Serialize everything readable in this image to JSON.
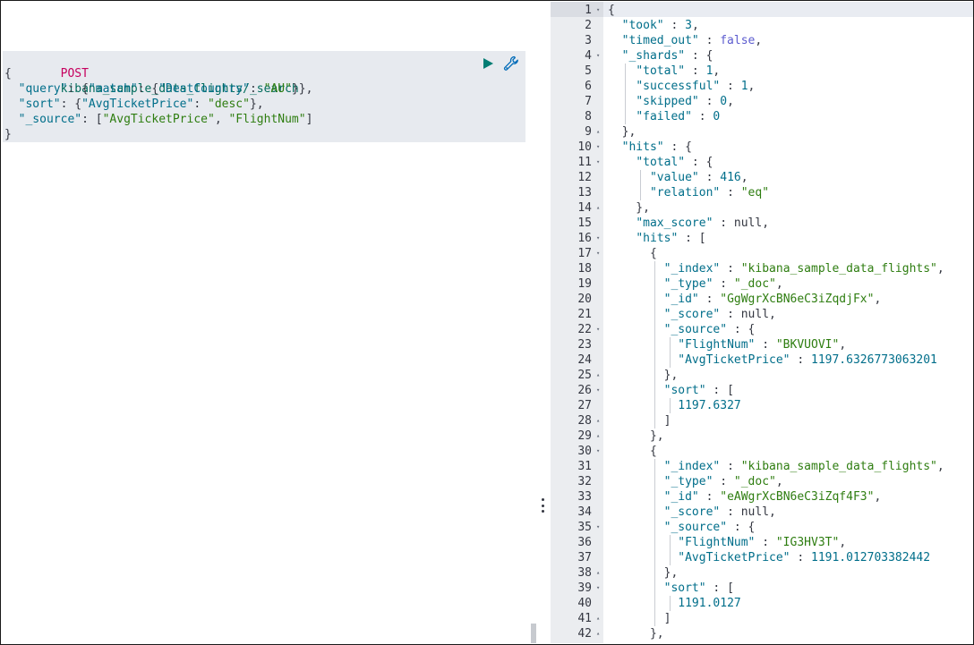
{
  "request": {
    "method": "POST",
    "path": "kibana_sample_data_flights/_search",
    "body": [
      [
        [
          "punc",
          "{"
        ]
      ],
      [
        [
          "punc",
          "  "
        ],
        [
          "key",
          "\"query\""
        ],
        [
          "punc",
          ": {"
        ],
        [
          "key",
          "\"match\""
        ],
        [
          "punc",
          ": {"
        ],
        [
          "key",
          "\"DestCountry\""
        ],
        [
          "punc",
          ": "
        ],
        [
          "str",
          "\"AU\""
        ],
        [
          "punc",
          "}},"
        ]
      ],
      [
        [
          "punc",
          "  "
        ],
        [
          "key",
          "\"sort\""
        ],
        [
          "punc",
          ": {"
        ],
        [
          "key",
          "\"AvgTicketPrice\""
        ],
        [
          "punc",
          ": "
        ],
        [
          "str",
          "\"desc\""
        ],
        [
          "punc",
          "},"
        ]
      ],
      [
        [
          "punc",
          "  "
        ],
        [
          "key",
          "\"_source\""
        ],
        [
          "punc",
          ": ["
        ],
        [
          "str",
          "\"AvgTicketPrice\""
        ],
        [
          "punc",
          ", "
        ],
        [
          "str",
          "\"FlightNum\""
        ],
        [
          "punc",
          "]"
        ]
      ],
      [
        [
          "punc",
          "}"
        ]
      ]
    ],
    "play_icon": "play-icon",
    "wrench_icon": "wrench-icon",
    "accent_color": "#017d73"
  },
  "response": {
    "lines": [
      {
        "n": "1",
        "fold": "▾",
        "t": [
          [
            "p",
            "{"
          ]
        ]
      },
      {
        "n": "2",
        "fold": "",
        "t": [
          [
            "p",
            "  "
          ],
          [
            "k",
            "\"took\""
          ],
          [
            "p",
            " : "
          ],
          [
            "n",
            "3"
          ],
          [
            "p",
            ","
          ]
        ]
      },
      {
        "n": "3",
        "fold": "",
        "t": [
          [
            "p",
            "  "
          ],
          [
            "k",
            "\"timed_out\""
          ],
          [
            "p",
            " : "
          ],
          [
            "b",
            "false"
          ],
          [
            "p",
            ","
          ]
        ]
      },
      {
        "n": "4",
        "fold": "▾",
        "t": [
          [
            "p",
            "  "
          ],
          [
            "k",
            "\"_shards\""
          ],
          [
            "p",
            " : {"
          ]
        ]
      },
      {
        "n": "5",
        "fold": "",
        "t": [
          [
            "p",
            "    "
          ],
          [
            "k",
            "\"total\""
          ],
          [
            "p",
            " : "
          ],
          [
            "n",
            "1"
          ],
          [
            "p",
            ","
          ]
        ]
      },
      {
        "n": "6",
        "fold": "",
        "t": [
          [
            "p",
            "    "
          ],
          [
            "k",
            "\"successful\""
          ],
          [
            "p",
            " : "
          ],
          [
            "n",
            "1"
          ],
          [
            "p",
            ","
          ]
        ]
      },
      {
        "n": "7",
        "fold": "",
        "t": [
          [
            "p",
            "    "
          ],
          [
            "k",
            "\"skipped\""
          ],
          [
            "p",
            " : "
          ],
          [
            "n",
            "0"
          ],
          [
            "p",
            ","
          ]
        ]
      },
      {
        "n": "8",
        "fold": "",
        "t": [
          [
            "p",
            "    "
          ],
          [
            "k",
            "\"failed\""
          ],
          [
            "p",
            " : "
          ],
          [
            "n",
            "0"
          ]
        ]
      },
      {
        "n": "9",
        "fold": "▴",
        "t": [
          [
            "p",
            "  },"
          ]
        ]
      },
      {
        "n": "10",
        "fold": "▾",
        "t": [
          [
            "p",
            "  "
          ],
          [
            "k",
            "\"hits\""
          ],
          [
            "p",
            " : {"
          ]
        ]
      },
      {
        "n": "11",
        "fold": "▾",
        "t": [
          [
            "p",
            "    "
          ],
          [
            "k",
            "\"total\""
          ],
          [
            "p",
            " : {"
          ]
        ]
      },
      {
        "n": "12",
        "fold": "",
        "t": [
          [
            "p",
            "      "
          ],
          [
            "k",
            "\"value\""
          ],
          [
            "p",
            " : "
          ],
          [
            "n",
            "416"
          ],
          [
            "p",
            ","
          ]
        ]
      },
      {
        "n": "13",
        "fold": "",
        "t": [
          [
            "p",
            "      "
          ],
          [
            "k",
            "\"relation\""
          ],
          [
            "p",
            " : "
          ],
          [
            "s",
            "\"eq\""
          ]
        ]
      },
      {
        "n": "14",
        "fold": "▴",
        "t": [
          [
            "p",
            "    },"
          ]
        ]
      },
      {
        "n": "15",
        "fold": "",
        "t": [
          [
            "p",
            "    "
          ],
          [
            "k",
            "\"max_score\""
          ],
          [
            "p",
            " : null,"
          ]
        ]
      },
      {
        "n": "16",
        "fold": "▾",
        "t": [
          [
            "p",
            "    "
          ],
          [
            "k",
            "\"hits\""
          ],
          [
            "p",
            " : ["
          ]
        ]
      },
      {
        "n": "17",
        "fold": "▾",
        "t": [
          [
            "p",
            "      {"
          ]
        ]
      },
      {
        "n": "18",
        "fold": "",
        "t": [
          [
            "p",
            "        "
          ],
          [
            "k",
            "\"_index\""
          ],
          [
            "p",
            " : "
          ],
          [
            "s",
            "\"kibana_sample_data_flights\""
          ],
          [
            "p",
            ","
          ]
        ]
      },
      {
        "n": "19",
        "fold": "",
        "t": [
          [
            "p",
            "        "
          ],
          [
            "k",
            "\"_type\""
          ],
          [
            "p",
            " : "
          ],
          [
            "s",
            "\"_doc\""
          ],
          [
            "p",
            ","
          ]
        ]
      },
      {
        "n": "20",
        "fold": "",
        "t": [
          [
            "p",
            "        "
          ],
          [
            "k",
            "\"_id\""
          ],
          [
            "p",
            " : "
          ],
          [
            "s",
            "\"GgWgrXcBN6eC3iZqdjFx\""
          ],
          [
            "p",
            ","
          ]
        ]
      },
      {
        "n": "21",
        "fold": "",
        "t": [
          [
            "p",
            "        "
          ],
          [
            "k",
            "\"_score\""
          ],
          [
            "p",
            " : null,"
          ]
        ]
      },
      {
        "n": "22",
        "fold": "▾",
        "t": [
          [
            "p",
            "        "
          ],
          [
            "k",
            "\"_source\""
          ],
          [
            "p",
            " : {"
          ]
        ]
      },
      {
        "n": "23",
        "fold": "",
        "t": [
          [
            "p",
            "          "
          ],
          [
            "k",
            "\"FlightNum\""
          ],
          [
            "p",
            " : "
          ],
          [
            "s",
            "\"BKVUOVI\""
          ],
          [
            "p",
            ","
          ]
        ]
      },
      {
        "n": "24",
        "fold": "",
        "t": [
          [
            "p",
            "          "
          ],
          [
            "k",
            "\"AvgTicketPrice\""
          ],
          [
            "p",
            " : "
          ],
          [
            "n",
            "1197.6326773063201"
          ]
        ]
      },
      {
        "n": "25",
        "fold": "▴",
        "t": [
          [
            "p",
            "        },"
          ]
        ]
      },
      {
        "n": "26",
        "fold": "▾",
        "t": [
          [
            "p",
            "        "
          ],
          [
            "k",
            "\"sort\""
          ],
          [
            "p",
            " : ["
          ]
        ]
      },
      {
        "n": "27",
        "fold": "",
        "t": [
          [
            "p",
            "          "
          ],
          [
            "n",
            "1197.6327"
          ]
        ]
      },
      {
        "n": "28",
        "fold": "▴",
        "t": [
          [
            "p",
            "        ]"
          ]
        ]
      },
      {
        "n": "29",
        "fold": "▴",
        "t": [
          [
            "p",
            "      },"
          ]
        ]
      },
      {
        "n": "30",
        "fold": "▾",
        "t": [
          [
            "p",
            "      {"
          ]
        ]
      },
      {
        "n": "31",
        "fold": "",
        "t": [
          [
            "p",
            "        "
          ],
          [
            "k",
            "\"_index\""
          ],
          [
            "p",
            " : "
          ],
          [
            "s",
            "\"kibana_sample_data_flights\""
          ],
          [
            "p",
            ","
          ]
        ]
      },
      {
        "n": "32",
        "fold": "",
        "t": [
          [
            "p",
            "        "
          ],
          [
            "k",
            "\"_type\""
          ],
          [
            "p",
            " : "
          ],
          [
            "s",
            "\"_doc\""
          ],
          [
            "p",
            ","
          ]
        ]
      },
      {
        "n": "33",
        "fold": "",
        "t": [
          [
            "p",
            "        "
          ],
          [
            "k",
            "\"_id\""
          ],
          [
            "p",
            " : "
          ],
          [
            "s",
            "\"eAWgrXcBN6eC3iZqf4F3\""
          ],
          [
            "p",
            ","
          ]
        ]
      },
      {
        "n": "34",
        "fold": "",
        "t": [
          [
            "p",
            "        "
          ],
          [
            "k",
            "\"_score\""
          ],
          [
            "p",
            " : null,"
          ]
        ]
      },
      {
        "n": "35",
        "fold": "▾",
        "t": [
          [
            "p",
            "        "
          ],
          [
            "k",
            "\"_source\""
          ],
          [
            "p",
            " : {"
          ]
        ]
      },
      {
        "n": "36",
        "fold": "",
        "t": [
          [
            "p",
            "          "
          ],
          [
            "k",
            "\"FlightNum\""
          ],
          [
            "p",
            " : "
          ],
          [
            "s",
            "\"IG3HV3T\""
          ],
          [
            "p",
            ","
          ]
        ]
      },
      {
        "n": "37",
        "fold": "",
        "t": [
          [
            "p",
            "          "
          ],
          [
            "k",
            "\"AvgTicketPrice\""
          ],
          [
            "p",
            " : "
          ],
          [
            "n",
            "1191.012703382442"
          ]
        ]
      },
      {
        "n": "38",
        "fold": "▴",
        "t": [
          [
            "p",
            "        },"
          ]
        ]
      },
      {
        "n": "39",
        "fold": "▾",
        "t": [
          [
            "p",
            "        "
          ],
          [
            "k",
            "\"sort\""
          ],
          [
            "p",
            " : ["
          ]
        ]
      },
      {
        "n": "40",
        "fold": "",
        "t": [
          [
            "p",
            "          "
          ],
          [
            "n",
            "1191.0127"
          ]
        ]
      },
      {
        "n": "41",
        "fold": "▴",
        "t": [
          [
            "p",
            "        ]"
          ]
        ]
      },
      {
        "n": "42",
        "fold": "▴",
        "t": [
          [
            "p",
            "      },"
          ]
        ]
      }
    ]
  },
  "resizer": {
    "icon": "drag-handle-icon"
  }
}
